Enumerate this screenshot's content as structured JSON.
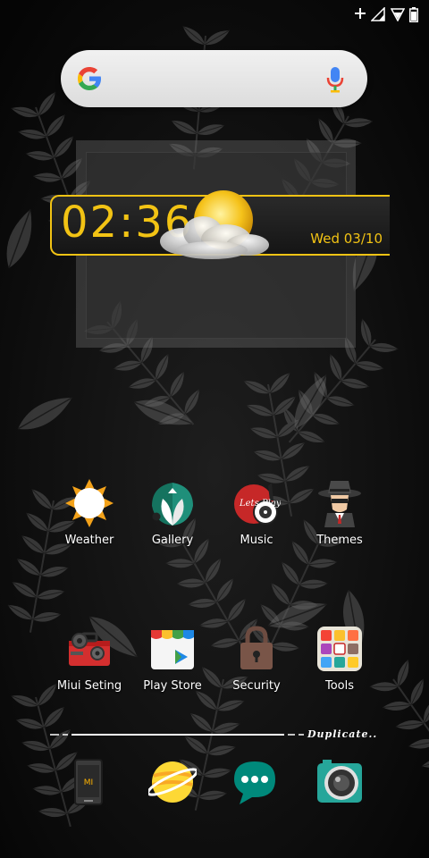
{
  "status_bar": {
    "icons": [
      "add-icon",
      "signal-icon",
      "wifi-icon",
      "battery-icon"
    ]
  },
  "search": {
    "icons": [
      "google-logo-icon",
      "mic-icon"
    ]
  },
  "clock_widget": {
    "time": "02:36",
    "date": "Wed 03/10",
    "accent": "#f2c314",
    "weather_icon": "partly-cloudy-icon"
  },
  "apps_row1": [
    {
      "label": "Weather",
      "icon": "weather-icon"
    },
    {
      "label": "Gallery",
      "icon": "gallery-icon"
    },
    {
      "label": "Music",
      "icon": "music-icon"
    },
    {
      "label": "Themes",
      "icon": "themes-icon"
    }
  ],
  "apps_row2": [
    {
      "label": "Miui Seting",
      "icon": "toolbox-icon"
    },
    {
      "label": "Play Store",
      "icon": "play-store-icon"
    },
    {
      "label": "Security",
      "icon": "lock-icon"
    },
    {
      "label": "Tools",
      "icon": "tools-folder-icon"
    }
  ],
  "dock": {
    "divider_text": "Duplicate..",
    "apps": [
      "phone-icon",
      "browser-icon",
      "messages-icon",
      "camera-icon"
    ]
  }
}
